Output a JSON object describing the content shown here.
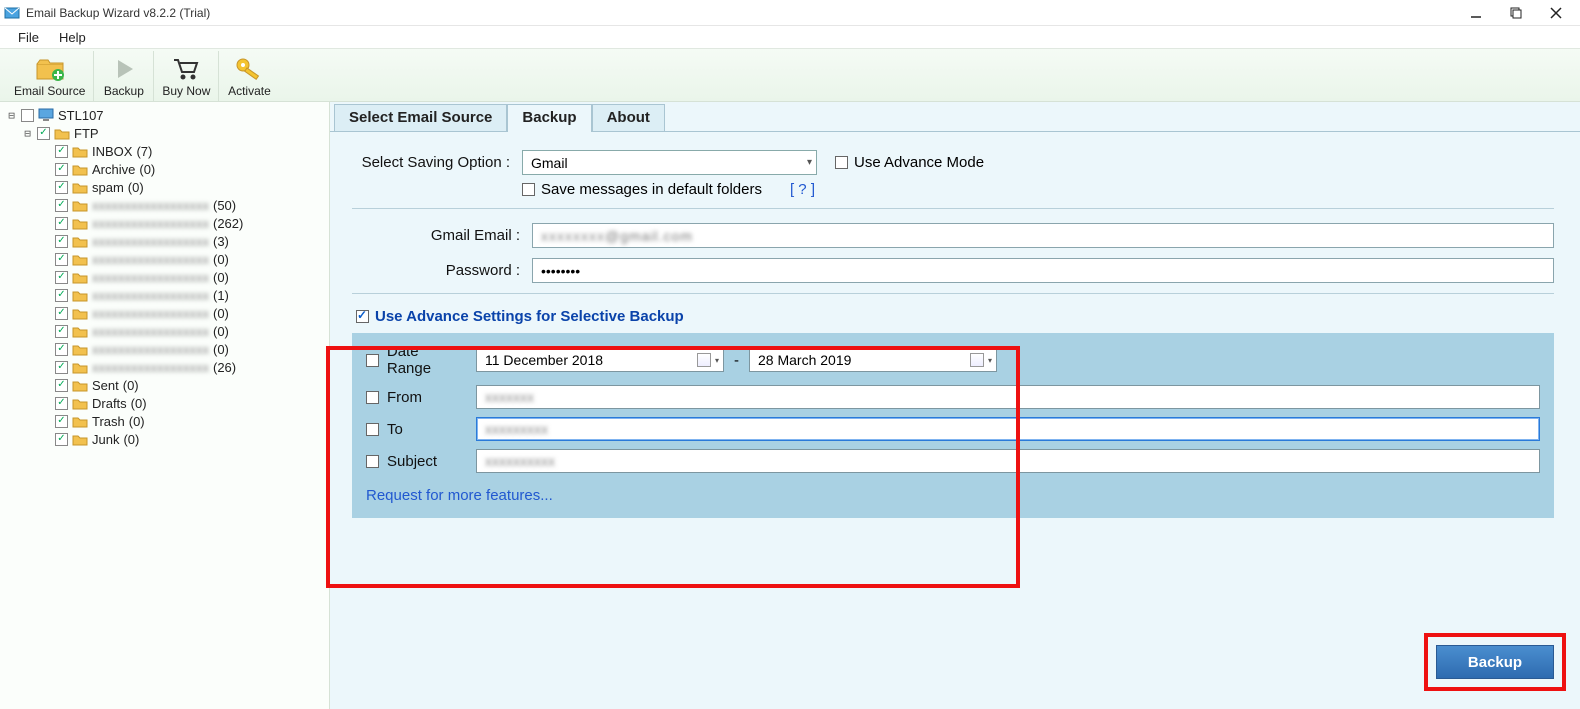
{
  "title": "Email Backup Wizard v8.2.2 (Trial)",
  "menu": {
    "file": "File",
    "help": "Help"
  },
  "toolbar": {
    "email_source": "Email Source",
    "backup": "Backup",
    "buy_now": "Buy Now",
    "activate": "Activate"
  },
  "tree": {
    "root": "STL107",
    "ftp": "FTP",
    "items": [
      {
        "label": "INBOX",
        "count": "(7)"
      },
      {
        "label": "Archive",
        "count": "(0)"
      },
      {
        "label": "spam",
        "count": "(0)"
      },
      {
        "label": "obscured-a",
        "count": "(50)",
        "obscured": true
      },
      {
        "label": "obscured-b",
        "count": "(262)",
        "obscured": true
      },
      {
        "label": "obscured-c",
        "count": "(3)",
        "obscured": true
      },
      {
        "label": "obscured-d",
        "count": "(0)",
        "obscured": true
      },
      {
        "label": "obscured-e",
        "count": "(0)",
        "obscured": true
      },
      {
        "label": "obscured-f",
        "count": "(1)",
        "obscured": true
      },
      {
        "label": "obscured-g",
        "count": "(0)",
        "obscured": true
      },
      {
        "label": "obscured-h_in",
        "count": "(0)",
        "obscured": true
      },
      {
        "label": "obscured-i",
        "count": "(0)",
        "obscured": true
      },
      {
        "label": "obscured-j",
        "count": "(26)",
        "obscured": true
      },
      {
        "label": "Sent",
        "count": "(0)"
      },
      {
        "label": "Drafts",
        "count": "(0)"
      },
      {
        "label": "Trash",
        "count": "(0)"
      },
      {
        "label": "Junk",
        "count": "(0)"
      }
    ]
  },
  "tabs": {
    "t1": "Select Email Source",
    "t2": "Backup",
    "t3": "About"
  },
  "form": {
    "saving_label": "Select Saving Option :",
    "saving_value": "Gmail",
    "advance_mode": "Use Advance Mode",
    "save_default": "Save messages in default folders",
    "help": "[ ? ]",
    "email_label": "Gmail Email :",
    "email_value": "@gmail.com",
    "password_label": "Password :",
    "password_value": "••••••••",
    "adv_title": "Use Advance Settings for Selective Backup",
    "date_range": "Date Range",
    "date_from": "11   December   2018",
    "date_sep": "-",
    "date_to": "28     March      2019",
    "from": "From",
    "to": "To",
    "subject": "Subject",
    "from_val": "obscured",
    "to_val": "obscured",
    "subject_val": "obscured",
    "request": "Request for more features...",
    "backup_btn": "Backup"
  }
}
